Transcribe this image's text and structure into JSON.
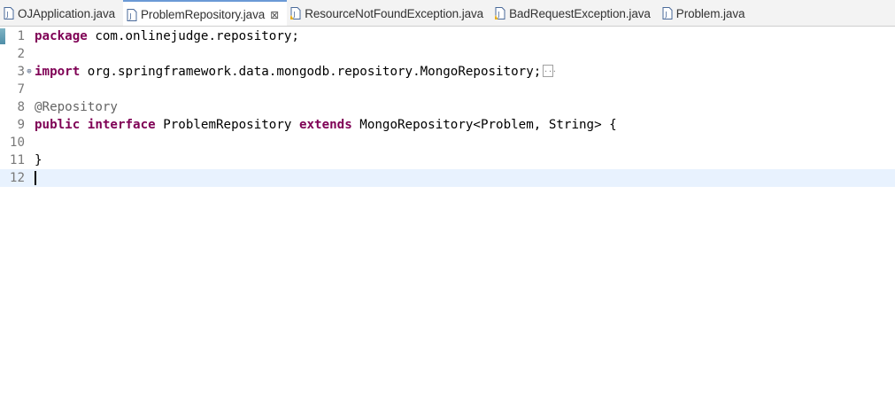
{
  "tabs": [
    {
      "label": "OJApplication.java",
      "icon": "java-file-icon",
      "active": false
    },
    {
      "label": "ProblemRepository.java",
      "icon": "java-file-icon",
      "active": true,
      "close": "⊠"
    },
    {
      "label": "ResourceNotFoundException.java",
      "icon": "java-file-warning-icon",
      "active": false
    },
    {
      "label": "BadRequestException.java",
      "icon": "java-file-warning-icon",
      "active": false
    },
    {
      "label": "Problem.java",
      "icon": "java-file-icon",
      "active": false
    }
  ],
  "colors": {
    "keyword": "#7f0055",
    "annotation": "#646464",
    "current_line": "#e8f2fe",
    "active_tab_accent": "#6b9ad6"
  },
  "lines": [
    {
      "number": "1",
      "kw": "package",
      "text": " com.onlinejudge.repository;"
    },
    {
      "number": "2",
      "text": ""
    },
    {
      "number": "3",
      "fold": "⊕",
      "kw": "import",
      "text": " org.springframework.data.mongodb.repository.MongoRepository;",
      "collapsed": true
    },
    {
      "number": "7",
      "text": ""
    },
    {
      "number": "8",
      "annotation": "@Repository"
    },
    {
      "number": "9",
      "kw": "public",
      "kw2": "interface",
      "text": " ProblemRepository ",
      "kw3": "extends",
      "text2": " MongoRepository<Problem, String> {"
    },
    {
      "number": "10",
      "text": ""
    },
    {
      "number": "11",
      "text": "}"
    },
    {
      "number": "12",
      "text": "",
      "current": true
    }
  ]
}
